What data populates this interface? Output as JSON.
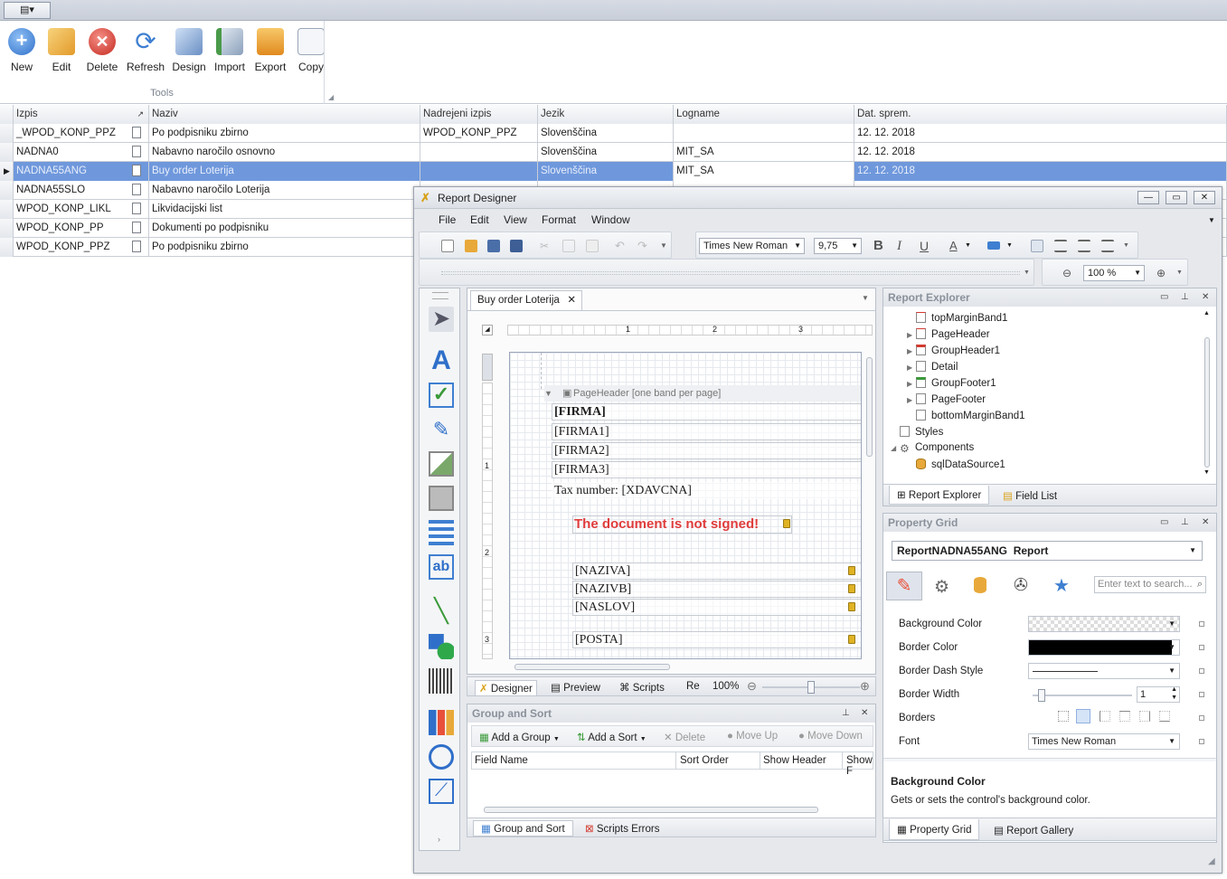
{
  "app": {
    "menu_glyph": "▤▾"
  },
  "ribbon": {
    "buttons": [
      {
        "label": "New",
        "icon": "plus-circle-icon",
        "color": "#3f7fd1"
      },
      {
        "label": "Edit",
        "icon": "pencil-folder-icon",
        "color": "#e8a93a"
      },
      {
        "label": "Delete",
        "icon": "delete-circle-icon",
        "color": "#d43a2f"
      },
      {
        "label": "Refresh",
        "icon": "refresh-icon",
        "color": "#5b8fcf"
      },
      {
        "label": "Design",
        "icon": "design-icon",
        "color": "#6a8fc4"
      },
      {
        "label": "Import",
        "icon": "import-icon",
        "color": "#4a9a4a"
      },
      {
        "label": "Export",
        "icon": "export-icon",
        "color": "#e39a2a"
      },
      {
        "label": "Copy",
        "icon": "copy-icon",
        "color": "#9aa6b8"
      }
    ],
    "group_label": "Tools"
  },
  "grid": {
    "columns": [
      "Izpis",
      "Naziv",
      "Nadrejeni izpis",
      "Jezik",
      "Logname",
      "Dat. sprem."
    ],
    "rows": [
      {
        "izpis": "_WPOD_KONP_PPZ",
        "naziv": "Po podpisniku zbirno",
        "nadrejeni": "WPOD_KONP_PPZ",
        "jezik": "Slovenščina",
        "logname": "",
        "dat": "12. 12. 2018"
      },
      {
        "izpis": "NADNA0",
        "naziv": "Nabavno naročilo osnovno",
        "nadrejeni": "",
        "jezik": "Slovenščina",
        "logname": "MIT_SA",
        "dat": "12. 12. 2018"
      },
      {
        "izpis": "NADNA55ANG",
        "naziv": "Buy order Loterija",
        "nadrejeni": "",
        "jezik": "Slovenščina",
        "logname": "MIT_SA",
        "dat": "12. 12. 2018"
      },
      {
        "izpis": "NADNA55SLO",
        "naziv": "Nabavno naročilo Loterija",
        "nadrejeni": "",
        "jezik": "",
        "logname": "",
        "dat": ""
      },
      {
        "izpis": "WPOD_KONP_LIKL",
        "naziv": "Likvidacijski list",
        "nadrejeni": "",
        "jezik": "",
        "logname": "",
        "dat": ""
      },
      {
        "izpis": "WPOD_KONP_PP",
        "naziv": "Dokumenti po podpisniku",
        "nadrejeni": "",
        "jezik": "",
        "logname": "",
        "dat": ""
      },
      {
        "izpis": "WPOD_KONP_PPZ",
        "naziv": "Po podpisniku zbirno",
        "nadrejeni": "",
        "jezik": "",
        "logname": "",
        "dat": ""
      }
    ],
    "selected_index": 2,
    "selection_color": "#6f98dc"
  },
  "designer": {
    "title": "Report Designer",
    "window_buttons": [
      "—",
      "▭",
      "✕"
    ],
    "menu": [
      "File",
      "Edit",
      "View",
      "Format",
      "Window"
    ],
    "font_name": "Times New Roman",
    "font_size": "9,75",
    "zoom_combo": "100 %",
    "doc_tab": "Buy order Loterija",
    "bands": {
      "page_header": "PageHeader [one band per page]",
      "firma": "[FIRMA]",
      "firma1": "[FIRMA1]",
      "firma2": "[FIRMA2]",
      "firma3": "[FIRMA3]",
      "tax": "Tax number: [XDAVCNA]",
      "not_signed": "The document is not signed!",
      "naziva": "[NAZIVA]",
      "nazivb": "[NAZIVB]",
      "naslov": "[NASLOV]",
      "posta": "[POSTA]"
    },
    "ruler_marks": [
      "1",
      "2",
      "3"
    ],
    "vruler_marks": [
      "1",
      "2",
      "3"
    ],
    "bottom_tabs": [
      "Designer",
      "Preview",
      "Scripts",
      "Re"
    ],
    "zoom_value": "100%",
    "zoom_slider_percent": 50,
    "group_sort": {
      "title": "Group and Sort",
      "add_group": "Add a Group",
      "add_sort": "Add a Sort",
      "delete": "Delete",
      "move_up": "Move Up",
      "move_down": "Move Down",
      "columns": [
        "Field Name",
        "Sort Order",
        "Show Header",
        "Show F"
      ]
    },
    "bottom_panel_tabs": [
      "Group and Sort",
      "Scripts Errors"
    ],
    "explorer": {
      "title": "Report Explorer",
      "items": [
        {
          "label": "topMarginBand1",
          "indent": 2,
          "arrow": ""
        },
        {
          "label": "PageHeader",
          "indent": 2,
          "arrow": "▶"
        },
        {
          "label": "GroupHeader1",
          "indent": 2,
          "arrow": "▶"
        },
        {
          "label": "Detail",
          "indent": 2,
          "arrow": "▶"
        },
        {
          "label": "GroupFooter1",
          "indent": 2,
          "arrow": "▶"
        },
        {
          "label": "PageFooter",
          "indent": 2,
          "arrow": "▶"
        },
        {
          "label": "bottomMarginBand1",
          "indent": 2,
          "arrow": ""
        },
        {
          "label": "Styles",
          "indent": 1,
          "arrow": ""
        },
        {
          "label": "Components",
          "indent": 1,
          "arrow": "◢"
        },
        {
          "label": "sqlDataSource1",
          "indent": 2,
          "arrow": ""
        }
      ],
      "tabs": [
        "Report Explorer",
        "Field List"
      ]
    },
    "property_grid": {
      "title": "Property Grid",
      "selector": "ReportNADNA55ANG",
      "selector_type": "Report",
      "search_placeholder": "Enter text to search...",
      "props": [
        {
          "label": "Background Color"
        },
        {
          "label": "Border Color"
        },
        {
          "label": "Border Dash Style"
        },
        {
          "label": "Border Width",
          "value": "1"
        },
        {
          "label": "Borders"
        },
        {
          "label": "Font",
          "value": "Times New Roman"
        }
      ],
      "desc_title": "Background Color",
      "desc_text": "Gets or sets the control's background color.",
      "tabs": [
        "Property Grid",
        "Report Gallery"
      ]
    }
  }
}
